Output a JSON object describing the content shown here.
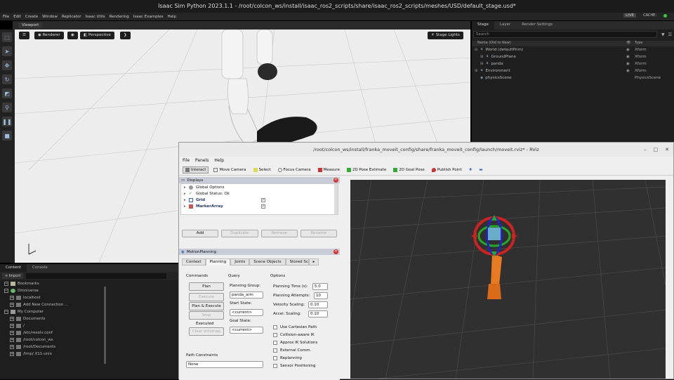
{
  "isaac": {
    "title": "Isaac Sim Python 2023.1.1 - /root/colcon_ws/install/isaac_ros2_scripts/share/isaac_ros2_scripts/meshes/USD/default_stage.usd*",
    "menu": [
      "File",
      "Edit",
      "Create",
      "Window",
      "Replicator",
      "Isaac Utils",
      "Rendering",
      "Isaac Examples",
      "Help"
    ],
    "live_label": "LIVE",
    "cache_label": "CACHE:",
    "viewport_tab": "Viewport",
    "renderer_label": "Renderer",
    "camera_label": "Perspective",
    "stage_lights_label": "Stage Lights",
    "stage": {
      "tabs": [
        "Stage",
        "Layer",
        "Render Settings"
      ],
      "search_placeholder": "Search",
      "col_name": "Name (Old to New)",
      "col_type": "Type",
      "rows": [
        {
          "name": "World (defaultPrim)",
          "type": "Xform"
        },
        {
          "name": "GroundPlane",
          "type": "Xform"
        },
        {
          "name": "panda",
          "type": "Xform"
        },
        {
          "name": "Environment",
          "type": "Xform"
        },
        {
          "name": "physicsScene",
          "type": "PhysicsScene"
        }
      ]
    },
    "content": {
      "tabs": [
        "Content",
        "Console"
      ],
      "import_label": "Import",
      "rows": [
        "Bookmarks",
        "Omniverse",
        "localhost",
        "Add New Connection ...",
        "My Computer",
        "Documents",
        "/",
        "/etc/resolv.conf",
        "/root/colcon_ws",
        "/root/Documents",
        "/tmp/.X11-unix"
      ]
    }
  },
  "rviz": {
    "title": "/root/colcon_ws/install/franka_moveit_config/share/franka_moveit_config/launch/moveit.rviz* - RViz",
    "menu": [
      "File",
      "Panels",
      "Help"
    ],
    "tools": [
      "Interact",
      "Move Camera",
      "Select",
      "Focus Camera",
      "Measure",
      "2D Pose Estimate",
      "2D Goal Pose",
      "Publish Point"
    ],
    "displays": {
      "title": "Displays",
      "items": [
        "Global Options",
        "Global Status: Ok",
        "Grid",
        "MarkerArray"
      ],
      "buttons": [
        "Add",
        "Duplicate",
        "Remove",
        "Rename"
      ]
    },
    "motion_planning": {
      "title": "MotionPlanning",
      "tabs": [
        "Context",
        "Planning",
        "Joints",
        "Scene Objects",
        "Stored Scenes"
      ],
      "commands_label": "Commands",
      "query_label": "Query",
      "options_label": "Options",
      "plan_btn": "Plan",
      "execute_btn": "Execute",
      "plan_execute_btn": "Plan & Execute",
      "stop_btn": "Stop",
      "status": "Executed",
      "clear_octomap_btn": "Clear octomap",
      "planning_group_label": "Planning Group:",
      "planning_group": "panda_arm",
      "start_state_label": "Start State:",
      "start_state": "<current>",
      "goal_state_label": "Goal State:",
      "goal_state": "<current>",
      "planning_time_label": "Planning Time (s):",
      "planning_time": "5.0",
      "planning_attempts_label": "Planning Attempts:",
      "planning_attempts": "10",
      "velocity_label": "Velocity Scaling:",
      "velocity": "0.10",
      "accel_label": "Accel. Scaling:",
      "accel": "0.10",
      "checkboxes": [
        "Use Cartesian Path",
        "Collision-aware IK",
        "Approx IK Solutions",
        "External Comm.",
        "Replanning",
        "Sensor Positioning"
      ],
      "path_constraints_label": "Path Constraints",
      "path_constraints": "None"
    }
  },
  "colors": {
    "accent": "#4a90e2",
    "panel_head": "#c8ccd6",
    "rviz_bg": "#303030",
    "robot": "#e87a22"
  }
}
